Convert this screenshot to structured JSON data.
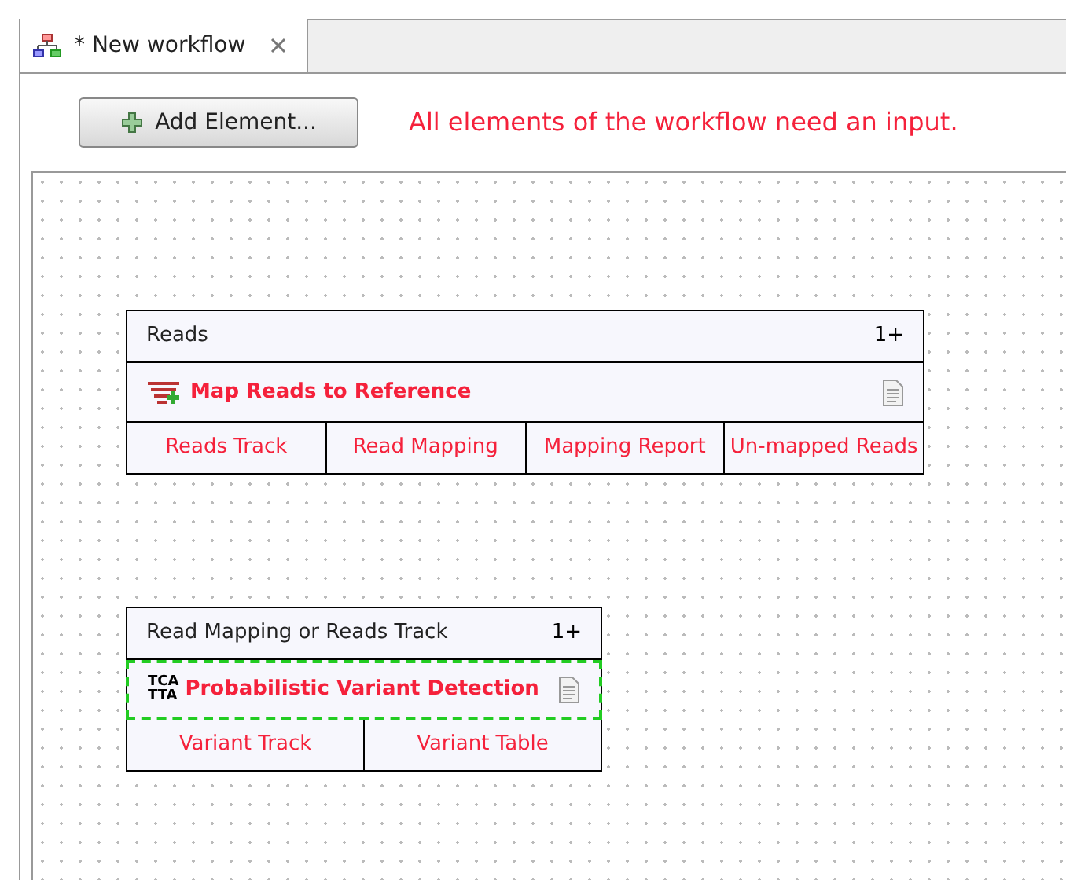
{
  "tab": {
    "label": "* New workflow",
    "selected": true
  },
  "toolbar": {
    "button": "Add Element...",
    "message": "All elements of the workflow need an input."
  },
  "canvas": {
    "nodes": [
      {
        "kind": "mapper",
        "input": "Reads",
        "multiplicity": "1+",
        "title": "Map Reads to Reference",
        "selected": false,
        "outputs": [
          "Reads Track",
          "Read Mapping",
          "Mapping Report",
          "Un-mapped Reads"
        ]
      },
      {
        "kind": "variant",
        "input": "Read Mapping or Reads Track",
        "multiplicity": "1+",
        "title": "Probabilistic Variant Detection",
        "icon_text": [
          "TCA",
          "TTA"
        ],
        "selected": true,
        "outputs": [
          "Variant Track",
          "Variant Table"
        ]
      }
    ]
  }
}
